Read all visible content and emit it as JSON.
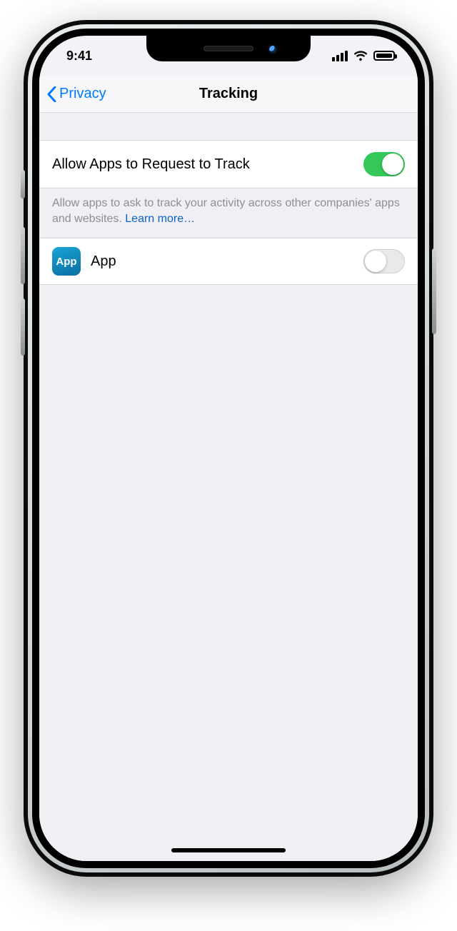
{
  "status": {
    "time": "9:41"
  },
  "nav": {
    "back_label": "Privacy",
    "title": "Tracking"
  },
  "tracking": {
    "allow_label": "Allow Apps to Request to Track",
    "allow_on": true,
    "footer_text": "Allow apps to ask to track your activity across other companies' apps and websites. ",
    "learn_more_label": "Learn more…"
  },
  "apps": [
    {
      "icon_text": "App",
      "name": "App",
      "tracking_on": false
    }
  ]
}
